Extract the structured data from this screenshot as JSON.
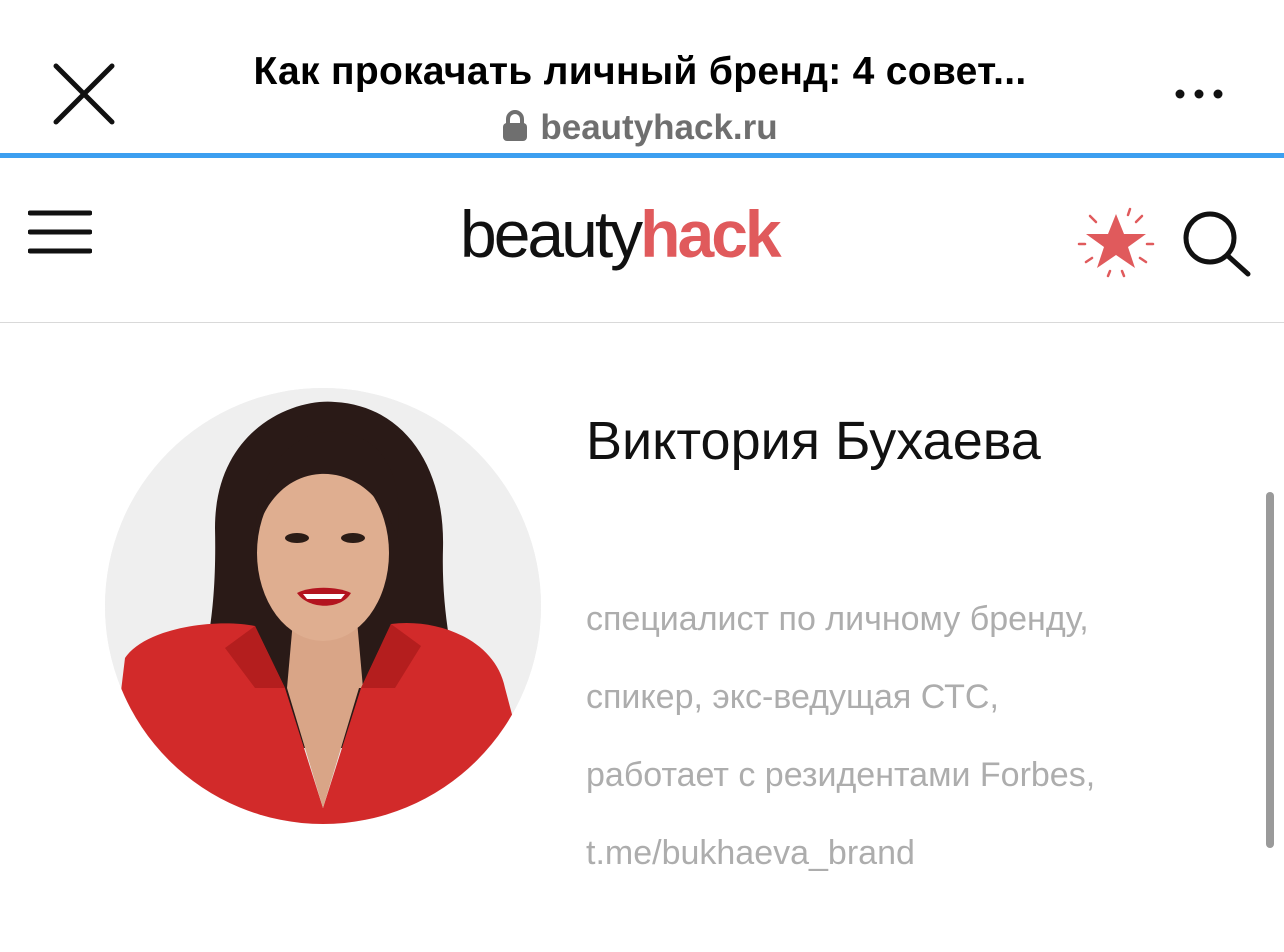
{
  "browser": {
    "title": "Как прокачать личный бренд: 4 совет...",
    "url": "beautyhack.ru",
    "close_icon": "close-icon",
    "more_icon": "more-dots-icon",
    "lock_icon": "lock-icon",
    "progress_color": "#3c9ff0",
    "progress_fraction": 1.0
  },
  "site": {
    "logo_part1": "beauty",
    "logo_part2": "hack",
    "brand_color": "#e05a5c",
    "menu_icon": "hamburger-menu-icon",
    "star_icon": "star-icon",
    "search_icon": "search-icon"
  },
  "author": {
    "name": "Виктория Бухаева",
    "bio_lines": [
      "специалист по личному бренду,",
      "спикер, экс-ведущая СТС,",
      "работает с резидентами Forbes,",
      "t.me/bukhaeva_brand"
    ]
  }
}
